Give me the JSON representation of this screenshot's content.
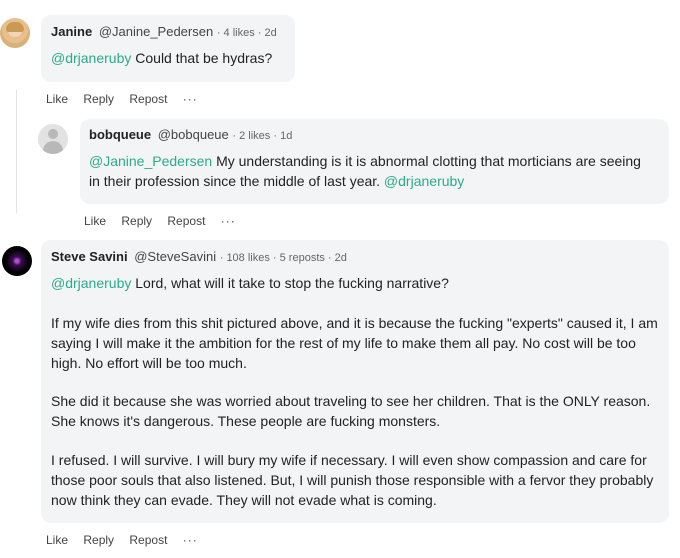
{
  "comments": [
    {
      "name": "Janine",
      "handle": "@Janine_Pedersen",
      "stats": "· 4 likes · 2d",
      "mention": "@drjaneruby",
      "text": " Could that be hydras?",
      "actions": [
        "Like",
        "Reply",
        "Repost",
        "···"
      ]
    },
    {
      "name": "bobqueue",
      "handle": "@bobqueue",
      "stats": "· 2 likes · 1d",
      "mention": "@Janine_Pedersen",
      "text": " My understanding is it is abnormal clotting that morticians are seeing in their profession since the middle of last year.",
      "mention2": " @drjaneruby",
      "actions": [
        "Like",
        "Reply",
        "Repost",
        "···"
      ]
    },
    {
      "name": "Steve Savini",
      "handle": "@SteveSavini",
      "stats": "· 108 likes · 5 reposts · 2d",
      "mention": "@drjaneruby",
      "text": " Lord, what will it take to stop the fucking narrative?",
      "paragraphs": [
        "If my wife dies from this shit pictured above, and it is because the fucking \"experts\" caused it, I am saying I will make it the ambition for the rest of my life to make them all pay. No cost will be too high. No effort will be too much.",
        "She did it because she was worried about traveling to see her children. That is the ONLY reason. She knows it's dangerous. These people are fucking monsters.",
        "I refused. I will survive. I will bury my wife if necessary. I will even show compassion and care for those poor souls that also listened. But, I will punish those responsible with a fervor they probably now think they can evade. They will not evade what is coming."
      ],
      "actions": [
        "Like",
        "Reply",
        "Repost",
        "···"
      ]
    }
  ]
}
